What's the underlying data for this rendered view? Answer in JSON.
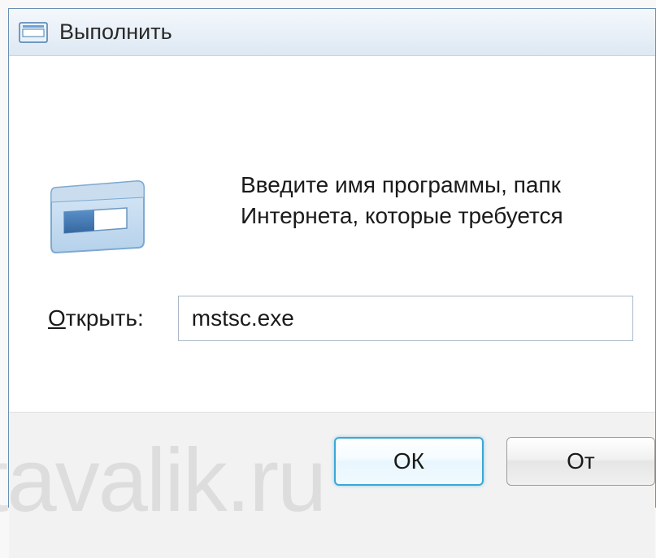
{
  "titlebar": {
    "title": "Выполнить"
  },
  "dialog": {
    "description_line1": "Введите имя программы, папк",
    "description_line2": "Интернета, которые требуется",
    "open_label_prefix": "О",
    "open_label_rest": "ткрыть:",
    "open_input_value": "mstsc.exe"
  },
  "buttons": {
    "ok": "ОК",
    "cancel": "От"
  },
  "watermark": "tavalik.ru"
}
